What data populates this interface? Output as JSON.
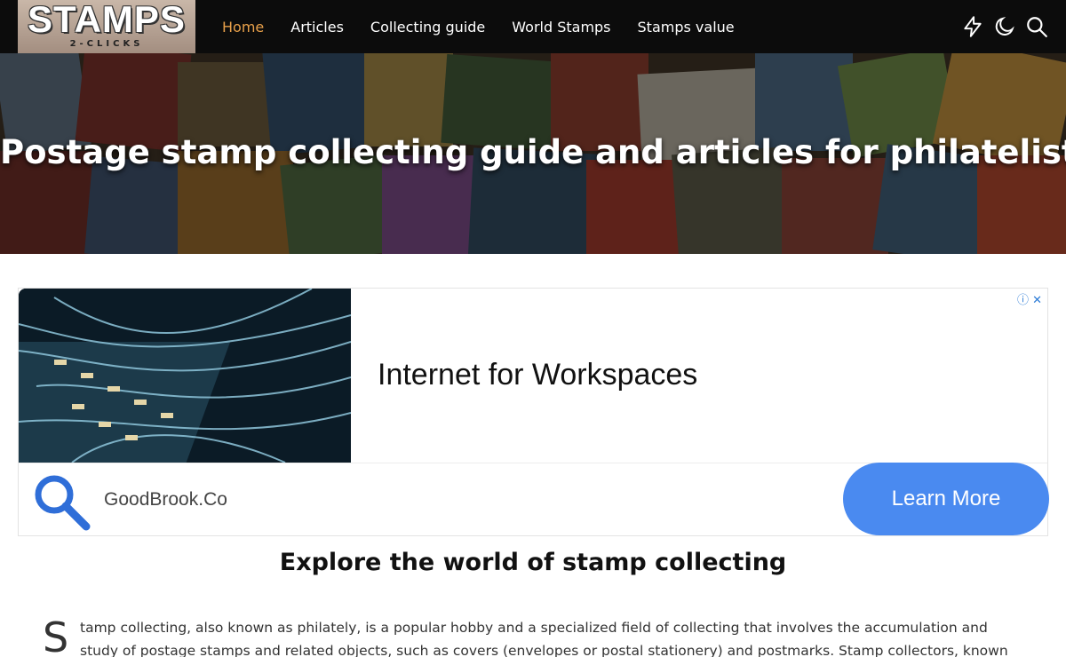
{
  "header": {
    "logo_main": "STAMPS",
    "logo_sub": "2-CLICKS",
    "nav": [
      {
        "label": "Home",
        "active": true
      },
      {
        "label": "Articles",
        "active": false
      },
      {
        "label": "Collecting guide",
        "active": false
      },
      {
        "label": "World Stamps",
        "active": false
      },
      {
        "label": "Stamps value",
        "active": false
      }
    ],
    "icons": [
      "lightning-icon",
      "moon-icon",
      "search-icon"
    ],
    "accent_color": "#e8a04a"
  },
  "hero": {
    "title": "Postage stamp collecting guide and articles for philatelists"
  },
  "ad": {
    "headline": "Internet for Workspaces",
    "advertiser": "GoodBrook.Co",
    "cta": "Learn More",
    "controls": "ⓘ ✕",
    "cta_color": "#4a8af0"
  },
  "article": {
    "section_title": "Explore the world of stamp collecting",
    "dropcap": "S",
    "intro": "tamp collecting, also known as philately, is a popular hobby and a specialized field of collecting that involves the accumulation and study of postage stamps and related objects, such as covers (envelopes or postal stationery) and postmarks. Stamp collectors, known as"
  }
}
